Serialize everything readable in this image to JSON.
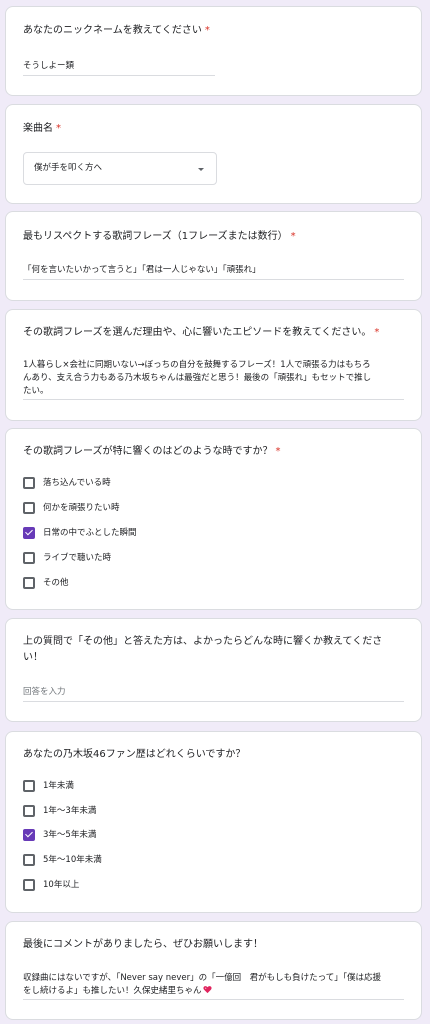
{
  "required_mark": "*",
  "q1": {
    "title": "あなたのニックネームを教えてください",
    "answer": "そうしよー類"
  },
  "q2": {
    "title": "楽曲名",
    "selected": "僕が手を叩く方へ"
  },
  "q3": {
    "title": "最もリスペクトする歌詞フレーズ（1フレーズまたは数行）",
    "answer": "「何を言いたいかって言うと」「君は一人じゃない」「頑張れ」"
  },
  "q4": {
    "title": "その歌詞フレーズを選んだ理由や、心に響いたエピソードを教えてください。",
    "answer_lines": [
      "1人暮らし×会社に同期いない→ぼっちの自分を鼓舞するフレーズ！1人で頑張る力はもちろ",
      "んあり、支え合う力もある乃木坂ちゃんは最強だと思う！最後の「頑張れ」もセットで推し",
      "たい。"
    ]
  },
  "q5": {
    "title": "その歌詞フレーズが特に響くのはどのような時ですか？",
    "options": [
      {
        "label": "落ち込んでいる時",
        "checked": false
      },
      {
        "label": "何かを頑張りたい時",
        "checked": false
      },
      {
        "label": "日常の中でふとした瞬間",
        "checked": true
      },
      {
        "label": "ライブで聴いた時",
        "checked": false
      },
      {
        "label": "その他",
        "checked": false
      }
    ]
  },
  "q6": {
    "title_lines": [
      "上の質問で「その他」と答えた方は、よかったらどんな時に響くか教えてくださ",
      "い！"
    ],
    "placeholder": "回答を入力"
  },
  "q7": {
    "title": "あなたの乃木坂46ファン歴はどれくらいですか？",
    "options": [
      {
        "label": "1年未満",
        "checked": false
      },
      {
        "label": "1年〜3年未満",
        "checked": false
      },
      {
        "label": "3年〜5年未満",
        "checked": true
      },
      {
        "label": "5年〜10年未満",
        "checked": false
      },
      {
        "label": "10年以上",
        "checked": false
      }
    ]
  },
  "q8": {
    "title": "最後にコメントがありましたら、ぜひお願いします！",
    "answer_lines": [
      "収録曲にはないですが、「Never say never」の「一億回　君がもしも負けたって」「僕は応援",
      "をし続けるよ」も推したい！久保史緒里ちゃん"
    ],
    "heart_icon": "sparkling-heart"
  },
  "colors": {
    "accent": "#673ab7",
    "required": "#d93025",
    "background": "#f0ebf8",
    "heart": "#e0245e"
  }
}
